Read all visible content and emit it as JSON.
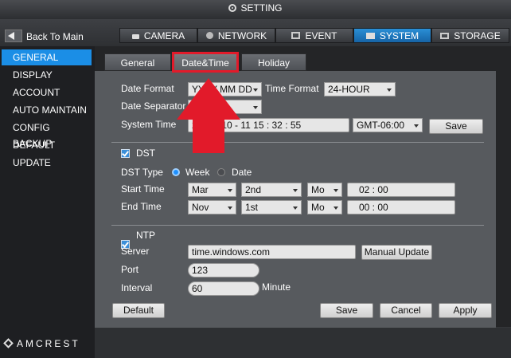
{
  "title": "SETTING",
  "nav": {
    "back": "Back To Main",
    "tabs": [
      "CAMERA",
      "NETWORK",
      "EVENT",
      "SYSTEM",
      "STORAGE"
    ],
    "active": "SYSTEM"
  },
  "sidebar": {
    "items": [
      "GENERAL",
      "DISPLAY",
      "ACCOUNT",
      "AUTO MAINTAIN",
      "CONFIG BACKUP",
      "DEFAULT",
      "UPDATE"
    ],
    "active": "GENERAL"
  },
  "brand": "AMCREST",
  "subtabs": [
    "General",
    "Date&Time",
    "Holiday"
  ],
  "subtab_active": "Date&Time",
  "datetime": {
    "date_format_label": "Date Format",
    "date_format_value": "YYYY MM DD",
    "time_format_label": "Time Format",
    "time_format_value": "24-HOUR",
    "date_separator_label": "Date Separator",
    "date_separator_value": "-",
    "system_time_label": "System Time",
    "system_time_value": "2018 - 10 - 11   15 : 32 : 55",
    "timezone_value": "GMT-06:00",
    "save_label": "Save"
  },
  "dst": {
    "label": "DST",
    "enabled": true,
    "type_label": "DST Type",
    "type_week": "Week",
    "type_date": "Date",
    "start_label": "Start Time",
    "start_month": "Mar",
    "start_week": "2nd",
    "start_day": "Mo",
    "start_time": "02 :  00",
    "end_label": "End Time",
    "end_month": "Nov",
    "end_week": "1st",
    "end_day": "Mo",
    "end_time": "00 :  00"
  },
  "ntp": {
    "label": "NTP",
    "enabled": true,
    "server_label": "Server",
    "server_value": "time.windows.com",
    "manual_update_label": "Manual Update",
    "port_label": "Port",
    "port_value": "123",
    "interval_label": "Interval",
    "interval_value": "60",
    "interval_unit": "Minute"
  },
  "actions": {
    "default": "Default",
    "save": "Save",
    "cancel": "Cancel",
    "apply": "Apply"
  },
  "colors": {
    "accent": "#1b8ee6",
    "highlight": "#e21a2a"
  }
}
